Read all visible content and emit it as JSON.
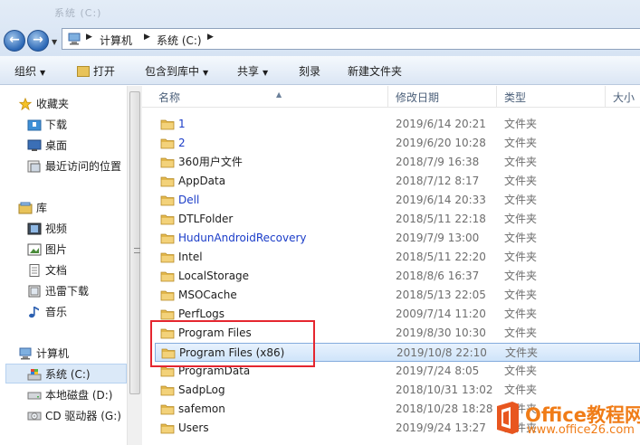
{
  "window": {
    "title": "系统 (C:)"
  },
  "address": {
    "path": [
      "计算机",
      "系统 (C:)"
    ]
  },
  "toolbar": {
    "organize": "组织",
    "open": "打开",
    "include_in_library": "包含到库中",
    "share": "共享",
    "burn": "刻录",
    "new_folder": "新建文件夹"
  },
  "nav": {
    "favorites": "收藏夹",
    "downloads": "下载",
    "desktop": "桌面",
    "recent": "最近访问的位置",
    "libraries": "库",
    "videos": "视频",
    "pictures": "图片",
    "documents": "文档",
    "thunder": "迅雷下载",
    "music": "音乐",
    "computer": "计算机",
    "system_c": "系统 (C:)",
    "local_d": "本地磁盘 (D:)",
    "cd_g": "CD 驱动器 (G:)"
  },
  "columns": {
    "name": "名称",
    "modified": "修改日期",
    "type": "类型",
    "size": "大小"
  },
  "files": [
    {
      "name": "1",
      "modified": "2019/6/14 20:21",
      "type": "文件夹",
      "color": "#1a3cc8"
    },
    {
      "name": "2",
      "modified": "2019/6/20 10:28",
      "type": "文件夹",
      "color": "#1a3cc8"
    },
    {
      "name": "360用户文件",
      "modified": "2018/7/9 16:38",
      "type": "文件夹",
      "color": "#1e1e1e"
    },
    {
      "name": "AppData",
      "modified": "2018/7/12 8:17",
      "type": "文件夹",
      "color": "#1e1e1e"
    },
    {
      "name": "Dell",
      "modified": "2019/6/14 20:33",
      "type": "文件夹",
      "color": "#1a3cc8"
    },
    {
      "name": "DTLFolder",
      "modified": "2018/5/11 22:18",
      "type": "文件夹",
      "color": "#1e1e1e"
    },
    {
      "name": "HudunAndroidRecovery",
      "modified": "2019/7/9 13:00",
      "type": "文件夹",
      "color": "#1a3cc8"
    },
    {
      "name": "Intel",
      "modified": "2018/5/11 22:20",
      "type": "文件夹",
      "color": "#1e1e1e"
    },
    {
      "name": "LocalStorage",
      "modified": "2018/8/6 16:37",
      "type": "文件夹",
      "color": "#1e1e1e"
    },
    {
      "name": "MSOCache",
      "modified": "2018/5/13 22:05",
      "type": "文件夹",
      "color": "#1e1e1e"
    },
    {
      "name": "PerfLogs",
      "modified": "2009/7/14 11:20",
      "type": "文件夹",
      "color": "#1e1e1e"
    },
    {
      "name": "Program Files",
      "modified": "2019/8/30 10:30",
      "type": "文件夹",
      "color": "#1e1e1e"
    },
    {
      "name": "Program Files (x86)",
      "modified": "2019/10/8 22:10",
      "type": "文件夹",
      "color": "#1e1e1e"
    },
    {
      "name": "ProgramData",
      "modified": "2019/7/24 8:05",
      "type": "文件夹",
      "color": "#1e1e1e"
    },
    {
      "name": "SadpLog",
      "modified": "2018/10/31 13:02",
      "type": "文件夹",
      "color": "#1e1e1e"
    },
    {
      "name": "safemon",
      "modified": "2018/10/28 18:28",
      "type": "文件夹",
      "color": "#1e1e1e"
    },
    {
      "name": "Users",
      "modified": "2019/9/24 13:27",
      "type": "文件夹",
      "color": "#1e1e1e"
    }
  ],
  "selected_index": 12,
  "watermark": {
    "name": "Office教程网",
    "url": "www.office26.com"
  }
}
